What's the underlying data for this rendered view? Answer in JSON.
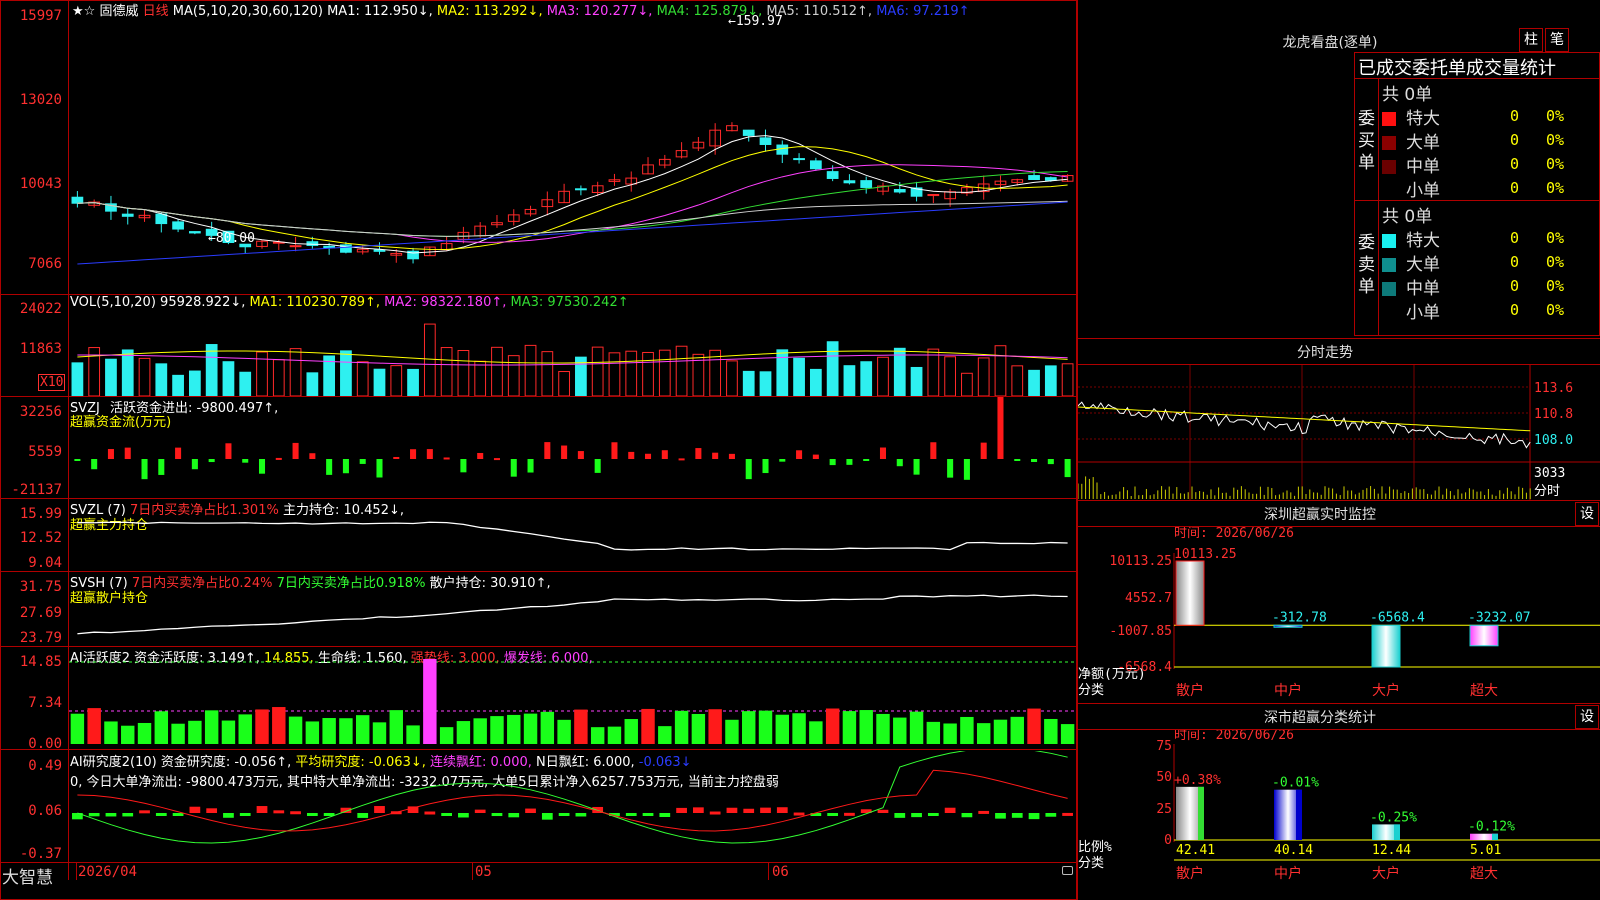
{
  "brand": "大智慧",
  "main": {
    "stock_name": "固德威",
    "period": "日线",
    "ma_header": "MA(5,10,20,30,60,120)",
    "ma1": "MA1: 112.950↓,",
    "ma2": "MA2: 113.292↓,",
    "ma3": "MA3: 120.277↓,",
    "ma4": "MA4: 125.879↓,",
    "ma5": "MA5: 110.512↑,",
    "ma6": "MA6: 97.219↑",
    "yticks": [
      "15997",
      "13020",
      "10043",
      "7066"
    ],
    "high_label": "159.97",
    "low_label": "80.00",
    "colors": {
      "up": "#ff2a2a",
      "down": "#2ef0f0",
      "ma1": "#ffffff",
      "ma2": "#ffff00",
      "ma3": "#ff40ff",
      "ma4": "#33dd33",
      "ma5": "#cfcfcf",
      "ma6": "#2a3cff"
    }
  },
  "vol": {
    "label": "VOL(5,10,20)",
    "value": "95928.922↓,",
    "ma1": "MA1: 110230.789↑,",
    "ma2": "MA2: 98322.180↑,",
    "ma3": "MA3: 97530.242↑",
    "yticks": [
      "24022",
      "11863"
    ],
    "unit": "X10"
  },
  "svzj": {
    "label": "SVZJ",
    "text": "活跃资金进出: -9800.497↑,",
    "subtitle": "超赢资金流(万元)",
    "yticks": [
      "32256",
      "5559",
      "-21137"
    ]
  },
  "svzl": {
    "label": "SVZL (7)",
    "ratio": "7日内买卖净占比1.301%",
    "hold": "主力持仓: 10.452↓,",
    "subtitle": "超赢主力持仓",
    "yticks": [
      "15.99",
      "12.52",
      "9.04"
    ]
  },
  "svsh": {
    "label": "SVSH (7)",
    "ratio1": "7日内买卖净占比0.24%",
    "ratio2": "7日内买卖净占比0.918%",
    "hold": "散户持仓: 30.910↑,",
    "subtitle": "超赢散户持仓",
    "yticks": [
      "31.75",
      "27.69",
      "23.79"
    ]
  },
  "ai1": {
    "label": "AI活跃度2",
    "t1": "资金活跃度: 3.149↑,",
    "t2": "14.855,",
    "t3": "生命线: 1.560,",
    "t4": "强势线: 3.000,",
    "t5": "爆发线: 6.000,",
    "yticks": [
      "14.85",
      "7.34",
      "0.00"
    ]
  },
  "ai2": {
    "label": "AI研究度2(10)",
    "t1": "资金研究度: -0.056↑,",
    "t2": "平均研究度: -0.063↓,",
    "t3": "连续飘红: 0.000,",
    "t4": "N日飘红: 6.000,",
    "t5": "-0.063↓",
    "note": "0, 今日大单净流出: -9800.473万元, 其中特大单净流出: -3232.07万元, 大单5日累计净入6257.753万元, 当前主力控盘弱",
    "yticks": [
      "0.49",
      "0.06",
      "-0.37"
    ]
  },
  "xaxis": {
    "labels": [
      "2026/04",
      "05",
      "06"
    ]
  },
  "dragon": {
    "title": "龙虎看盘(逐单)",
    "btn_bar": "柱",
    "btn_pen": "笔",
    "header": "已成交委托单成交量统计",
    "buy_group": "委买单",
    "sell_group": "委卖单",
    "buy_total": "共 0单",
    "sell_total": "共 0单",
    "buy_rows": [
      {
        "label": "特大",
        "color": "#ff1010",
        "val": "0",
        "pct": "0%"
      },
      {
        "label": "大单",
        "color": "#8b0000",
        "val": "0",
        "pct": "0%"
      },
      {
        "label": "中单",
        "color": "#6a0000",
        "val": "0",
        "pct": "0%"
      },
      {
        "label": "小单",
        "color": "#000000",
        "val": "0",
        "pct": "0%"
      }
    ],
    "sell_rows": [
      {
        "label": "特大",
        "color": "#19f0f0",
        "val": "0",
        "pct": "0%"
      },
      {
        "label": "大单",
        "color": "#0f8f8f",
        "val": "0",
        "pct": "0%"
      },
      {
        "label": "中单",
        "color": "#0d7a7a",
        "val": "0",
        "pct": "0%"
      },
      {
        "label": "小单",
        "color": "#000000",
        "val": "0",
        "pct": "0%"
      }
    ]
  },
  "fenshi": {
    "title": "分时走势",
    "yticks": [
      "113.6",
      "110.8",
      "108.0"
    ],
    "vol_tick": "3033",
    "vol_label": "分时"
  },
  "sz_monitor": {
    "title": "深圳超赢实时监控",
    "btn": "设",
    "time": "时间: 2026/06/26",
    "yticks": [
      "10113.25",
      "4552.7",
      "-1007.85",
      "-6568.4"
    ],
    "ylabel": "净额(万元)",
    "xlabel": "分类"
  },
  "sz_stats": {
    "title": "深市超赢分类统计",
    "btn": "设",
    "time": "时间: 2026/06/26",
    "yticks": [
      "75",
      "50",
      "25",
      "0"
    ],
    "ylabel": "比例%",
    "xlabel": "分类"
  },
  "chart_data": [
    {
      "type": "bar",
      "title": "深圳超赢实时监控",
      "categories": [
        "散户",
        "中户",
        "大户",
        "超大"
      ],
      "values": [
        10113.25,
        -312.78,
        -6568.4,
        -3232.07
      ],
      "ylim": [
        -6568.4,
        10113.25
      ],
      "ylabel": "净额(万元)",
      "xlabel": "分类"
    },
    {
      "type": "bar",
      "title": "深市超赢分类统计",
      "categories": [
        "散户",
        "中户",
        "大户",
        "超大"
      ],
      "values": [
        42.41,
        40.14,
        12.44,
        5.01
      ],
      "changes": [
        "+0.38%",
        "-0.01%",
        "-0.25%",
        "-0.12%"
      ],
      "ylim": [
        0,
        75
      ],
      "ylabel": "比例%",
      "xlabel": "分类"
    }
  ]
}
